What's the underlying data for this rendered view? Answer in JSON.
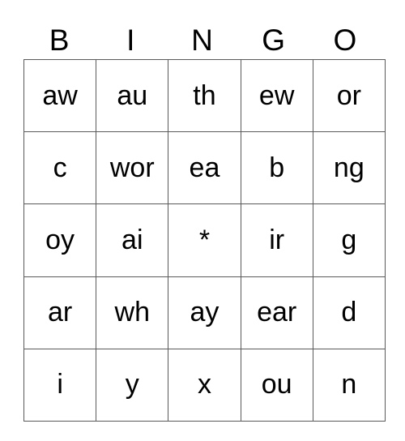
{
  "header": [
    "B",
    "I",
    "N",
    "G",
    "O"
  ],
  "rows": [
    [
      "aw",
      "au",
      "th",
      "ew",
      "or"
    ],
    [
      "c",
      "wor",
      "ea",
      "b",
      "ng"
    ],
    [
      "oy",
      "ai",
      "*",
      "ir",
      "g"
    ],
    [
      "ar",
      "wh",
      "ay",
      "ear",
      "d"
    ],
    [
      "i",
      "y",
      "x",
      "ou",
      "n"
    ]
  ]
}
